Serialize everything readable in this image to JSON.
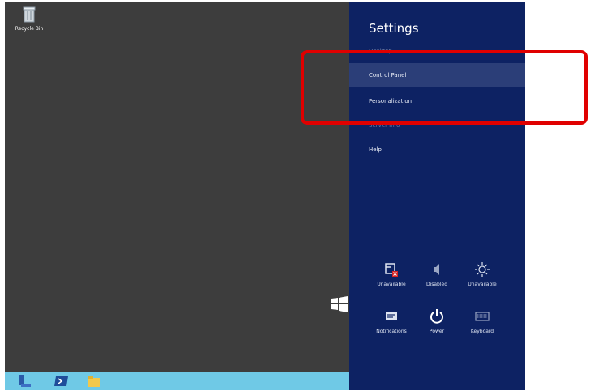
{
  "desktop": {
    "recycle_bin_label": "Recycle Bin"
  },
  "taskbar": {
    "icons": [
      "server-manager-icon",
      "powershell-icon",
      "file-explorer-icon"
    ]
  },
  "charm": {
    "title": "Settings",
    "items": [
      {
        "label": "Desktop"
      },
      {
        "label": "Control Panel"
      },
      {
        "label": "Personalization"
      },
      {
        "label": "Server Info"
      },
      {
        "label": "Help"
      }
    ],
    "tiles": [
      {
        "label": "Unavailable",
        "icon": "network-unavailable-icon"
      },
      {
        "label": "Disabled",
        "icon": "volume-icon"
      },
      {
        "label": "Unavailable",
        "icon": "brightness-icon"
      },
      {
        "label": "Notifications",
        "icon": "notifications-icon"
      },
      {
        "label": "Power",
        "icon": "power-icon"
      },
      {
        "label": "Keyboard",
        "icon": "keyboard-icon"
      }
    ]
  },
  "colors": {
    "charm_bg": "#0d2263",
    "highlight": "#e00000",
    "taskbar": "#6fc9e6",
    "desktop": "#3d3d3d"
  }
}
